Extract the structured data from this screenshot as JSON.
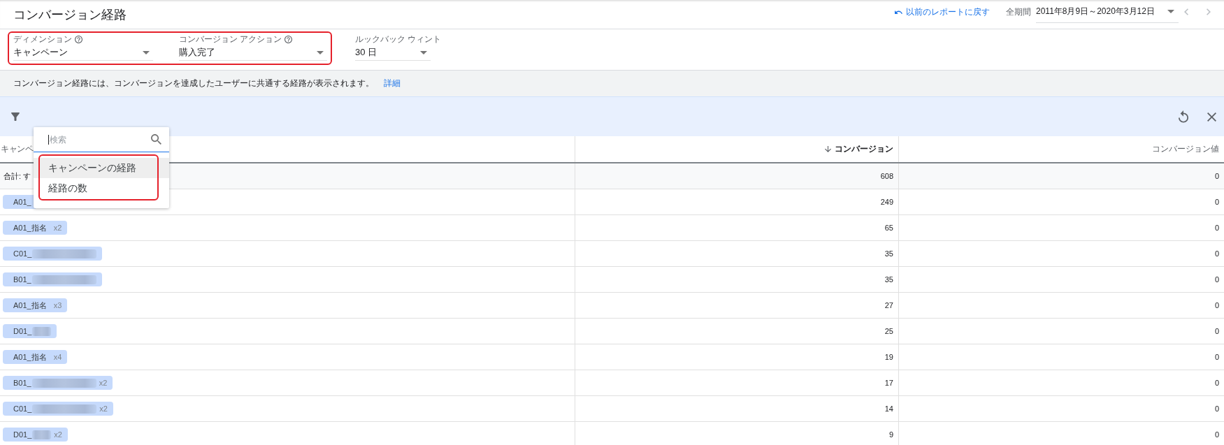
{
  "header": {
    "title": "コンバージョン経路",
    "back_link": "以前のレポートに戻す",
    "period_label": "全期間",
    "date_range": "2011年8月9日～2020年3月12日"
  },
  "filters": {
    "highlighted": true,
    "fields": [
      {
        "label": "ディメンション",
        "help": true,
        "value": "キャンペーン"
      },
      {
        "label": "コンバージョン アクション",
        "help": true,
        "value": "購入完了"
      },
      {
        "label": "ルックバック ウィント",
        "value": "30 日"
      }
    ]
  },
  "info": {
    "text": "コンバージョン経路には、コンバージョンを達成したユーザーに共通する経路が表示されます。",
    "link": "詳細"
  },
  "table": {
    "columns": [
      {
        "label": "キャンペ",
        "sorted": false
      },
      {
        "label": "コンバージョン",
        "sorted": true
      },
      {
        "label": "コンバージョン値",
        "sorted": false
      }
    ],
    "total": {
      "label": "合計: す",
      "conversions": "608",
      "value": "0"
    },
    "rows": [
      {
        "path": [
          {
            "kind": "plain",
            "label": "A01_"
          }
        ],
        "conversions": "249",
        "value": "0"
      },
      {
        "path": [
          {
            "kind": "plain",
            "label": "A01_指名",
            "repeat": "x2"
          }
        ],
        "conversions": "65",
        "value": "0"
      },
      {
        "path": [
          {
            "kind": "longblur",
            "label": "C01_"
          }
        ],
        "conversions": "35",
        "value": "0"
      },
      {
        "path": [
          {
            "kind": "longblur",
            "label": "B01_"
          }
        ],
        "conversions": "35",
        "value": "0"
      },
      {
        "path": [
          {
            "kind": "plain",
            "label": "A01_指名",
            "repeat": "x3"
          }
        ],
        "conversions": "27",
        "value": "0"
      },
      {
        "path": [
          {
            "kind": "shortblur",
            "label": "D01_"
          }
        ],
        "conversions": "25",
        "value": "0"
      },
      {
        "path": [
          {
            "kind": "plain",
            "label": "A01_指名",
            "repeat": "x4"
          }
        ],
        "conversions": "19",
        "value": "0"
      },
      {
        "path": [
          {
            "kind": "longblur",
            "label": "B01_",
            "repeat": "x2"
          }
        ],
        "conversions": "17",
        "value": "0"
      },
      {
        "path": [
          {
            "kind": "longblur",
            "label": "C01_",
            "repeat": "x2"
          }
        ],
        "conversions": "14",
        "value": "0"
      },
      {
        "path": [
          {
            "kind": "shortblur",
            "label": "D01_",
            "repeat": "x2"
          }
        ],
        "conversions": "9",
        "value": "0"
      }
    ]
  },
  "dropdown": {
    "highlighted": true,
    "search": {
      "placeholder": "検索",
      "focused": true
    },
    "items": [
      {
        "label": "キャンペーンの経路",
        "selected": true
      },
      {
        "label": "経路の数",
        "selected": false
      }
    ]
  }
}
